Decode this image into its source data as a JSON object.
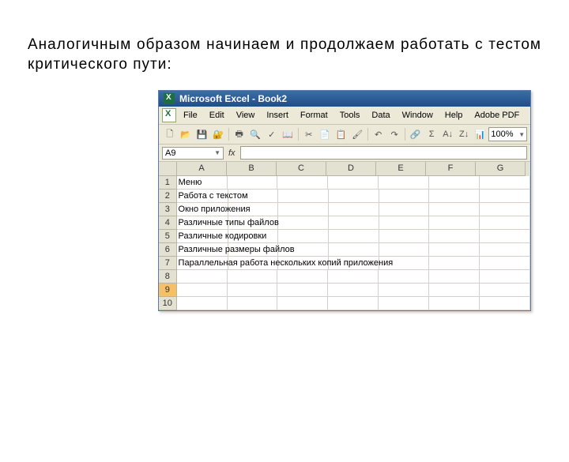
{
  "caption_text": "Аналогичным образом начинаем и продолжаем работать с тестом критического пути:",
  "title": "Microsoft Excel - Book2",
  "menu": {
    "file": "File",
    "edit": "Edit",
    "view": "View",
    "insert": "Insert",
    "format": "Format",
    "tools": "Tools",
    "data": "Data",
    "window": "Window",
    "help": "Help",
    "adobe": "Adobe PDF"
  },
  "zoom": "100%",
  "namebox": "A9",
  "fx_label": "fx",
  "columns": [
    "A",
    "B",
    "C",
    "D",
    "E",
    "F",
    "G"
  ],
  "rows": [
    {
      "num": "1",
      "a": "Меню"
    },
    {
      "num": "2",
      "a": "Работа с текстом"
    },
    {
      "num": "3",
      "a": "Окно приложения"
    },
    {
      "num": "4",
      "a": "Различные типы файлов"
    },
    {
      "num": "5",
      "a": "Различные кодировки"
    },
    {
      "num": "6",
      "a": "Различные размеры файлов"
    },
    {
      "num": "7",
      "a": "Параллельная работа нескольких копий приложения"
    },
    {
      "num": "8",
      "a": ""
    },
    {
      "num": "9",
      "a": ""
    },
    {
      "num": "10",
      "a": ""
    }
  ],
  "active_cell": "A9",
  "toolbar_icons": {
    "new": "🗋",
    "open": "📂",
    "save": "💾",
    "perm": "🔐",
    "print": "🖶",
    "preview": "🔍",
    "spell": "✓",
    "research": "📖",
    "cut": "✂",
    "copy": "📄",
    "paste": "📋",
    "painter": "🖌",
    "undo": "↶",
    "redo": "↷",
    "link": "🔗",
    "sum": "Σ",
    "sort_asc": "A↓",
    "sort_desc": "Z↓",
    "chart": "📊",
    "help": "?"
  }
}
